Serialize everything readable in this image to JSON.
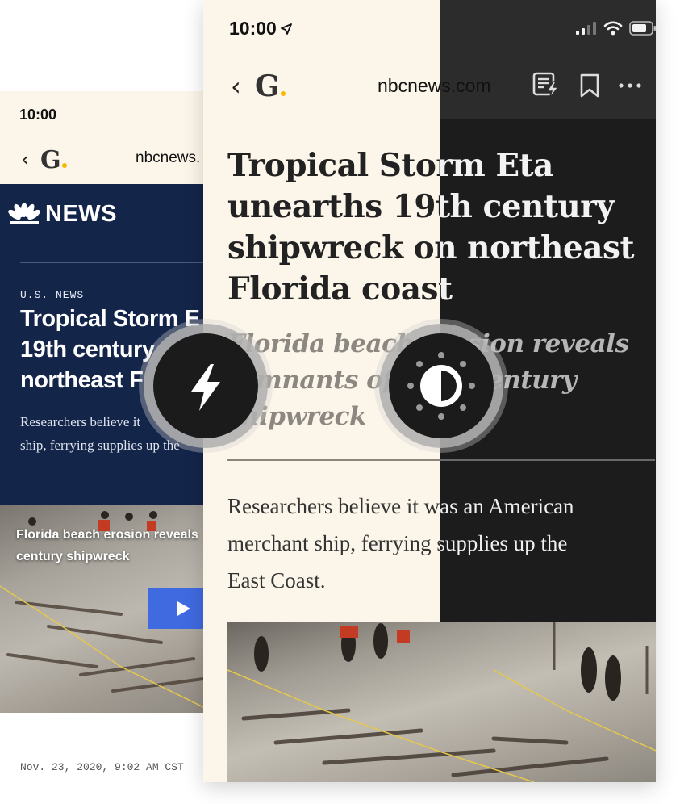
{
  "back_page": {
    "status": {
      "time": "10:00"
    },
    "nav": {
      "back_icon": "chevron-left-icon",
      "logo": "G",
      "url": "nbcnews."
    },
    "site": {
      "logo_text": "NEWS",
      "logo_icon": "peacock-icon",
      "brand_color": "#14254a"
    },
    "article": {
      "kicker": "U.S. NEWS",
      "title_lines": [
        "Tropical Storm E",
        "19th century",
        "northeast F"
      ],
      "summary_lines": [
        "Researchers believe it",
        "ship, ferrying supplies up the"
      ]
    },
    "video": {
      "caption_lines": [
        "Florida beach erosion reveals",
        "century shipwreck"
      ],
      "play_icon": "play-icon",
      "accent_color": "#3f6ae0"
    },
    "date": "Nov. 23, 2020, 9:02 AM CST"
  },
  "reader": {
    "status": {
      "time": "10:00",
      "location_icon": "location-arrow-icon",
      "signal_icon": "signal-icon",
      "wifi_icon": "wifi-icon",
      "battery_icon": "battery-icon"
    },
    "nav": {
      "back_icon": "chevron-left-icon",
      "logo": "G",
      "url": "nbcnews.com",
      "reader_icon": "reader-flash-icon",
      "bookmark_icon": "bookmark-icon",
      "more_icon": "more-horizontal-icon"
    },
    "article": {
      "headline_lines": [
        "Tropical Storm Eta",
        "unearths 19th century",
        "shipwreck on northeast",
        "Florida coast"
      ],
      "subhead_lines": [
        "Florida beach erosion reveals",
        "remnants of 19th century",
        "shipwreck"
      ],
      "body_lines": [
        "Researchers believe it was an American",
        "merchant ship, ferrying supplies up the",
        "East Coast."
      ]
    },
    "theme": {
      "light_bg": "#fcf6ea",
      "dark_bg": "#1c1c1c"
    }
  },
  "floating_buttons": {
    "flash": {
      "icon": "lightning-bolt-icon"
    },
    "theme": {
      "icon": "contrast-theme-icon"
    }
  }
}
